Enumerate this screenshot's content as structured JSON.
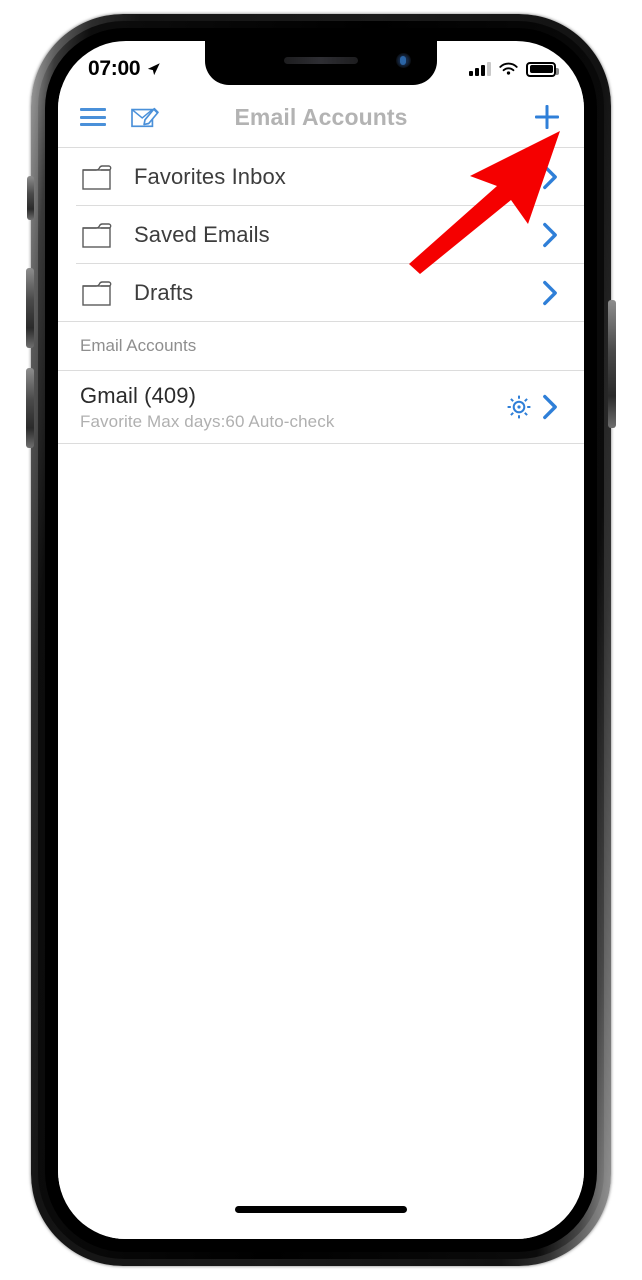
{
  "status_bar": {
    "time": "07:00",
    "location_icon": "location-arrow-icon",
    "signal_icon": "cellular-signal-icon",
    "wifi_icon": "wifi-icon",
    "battery_icon": "battery-full-icon"
  },
  "nav": {
    "menu_icon": "hamburger-menu-icon",
    "compose_icon": "compose-email-icon",
    "title": "Email Accounts",
    "add_icon": "plus-icon"
  },
  "folders": [
    {
      "label": "Favorites Inbox",
      "icon": "folder-icon",
      "chevron": "chevron-right-icon"
    },
    {
      "label": "Saved Emails",
      "icon": "folder-icon",
      "chevron": "chevron-right-icon"
    },
    {
      "label": "Drafts",
      "icon": "folder-icon",
      "chevron": "chevron-right-icon"
    }
  ],
  "section": {
    "header": "Email Accounts"
  },
  "accounts": [
    {
      "title": "Gmail (409)",
      "subtitle": "Favorite Max days:60 Auto-check",
      "settings_icon": "gear-icon",
      "chevron": "chevron-right-icon"
    }
  ],
  "annotation": {
    "arrow_icon": "red-arrow-pointing-to-plus-button",
    "color": "#f50000"
  },
  "colors": {
    "accent_blue": "#2f7fd8",
    "icon_blue": "#4a90d9",
    "title_gray": "#b3b3b3",
    "row_text": "#3d3d3d",
    "subtitle_gray": "#b0b0b0",
    "separator": "#dcdcdc",
    "background": "#ffffff"
  }
}
